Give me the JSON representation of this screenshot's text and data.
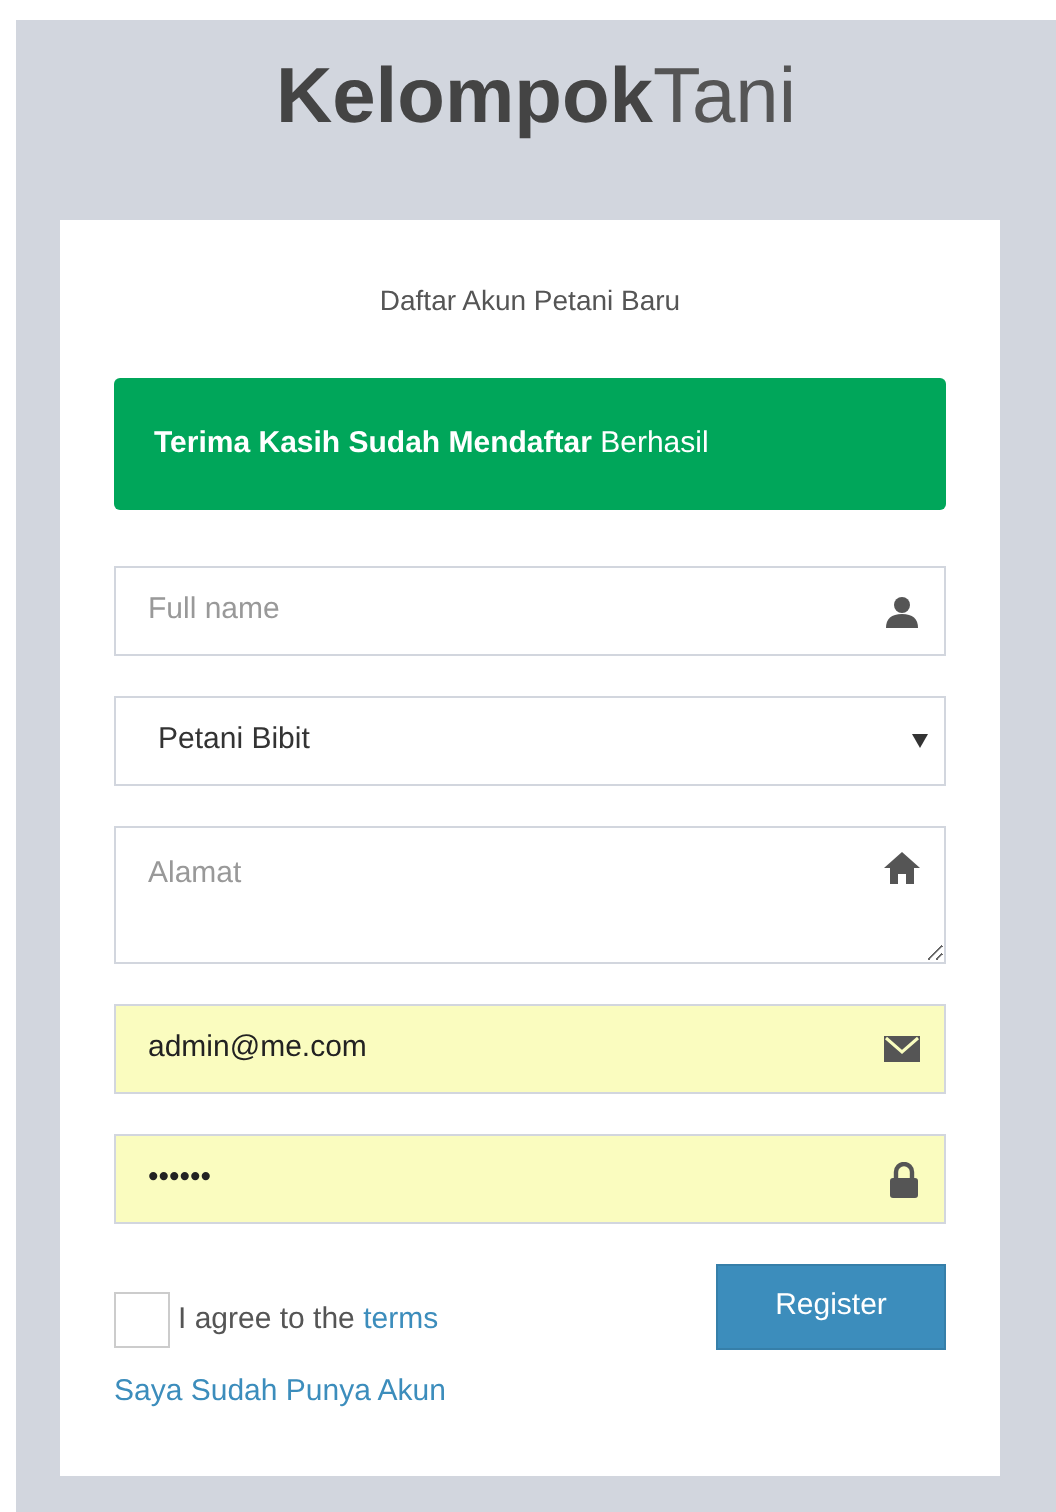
{
  "logo": {
    "bold": "Kelompok",
    "light": "Tani"
  },
  "subtitle": "Daftar Akun Petani Baru",
  "alert": "**Terima Kasih Sudah Mendaftar** Berhasil",
  "fields": [
    {
      "kind": "name",
      "placeholder": "Full name"
    },
    {
      "kind": "select",
      "value": "Petani Bibit"
    },
    {
      "kind": "address",
      "placeholder": "Alamat"
    },
    {
      "kind": "email",
      "value": "admin@me.com",
      "autofilled": true
    },
    {
      "kind": "password",
      "value": "••••••",
      "autofilled": true
    }
  ],
  "agree": {
    "checked": false,
    "text": "I agree to the",
    "link": "terms"
  },
  "register_button": "Register",
  "login_link": "Saya Sudah Punya Akun"
}
